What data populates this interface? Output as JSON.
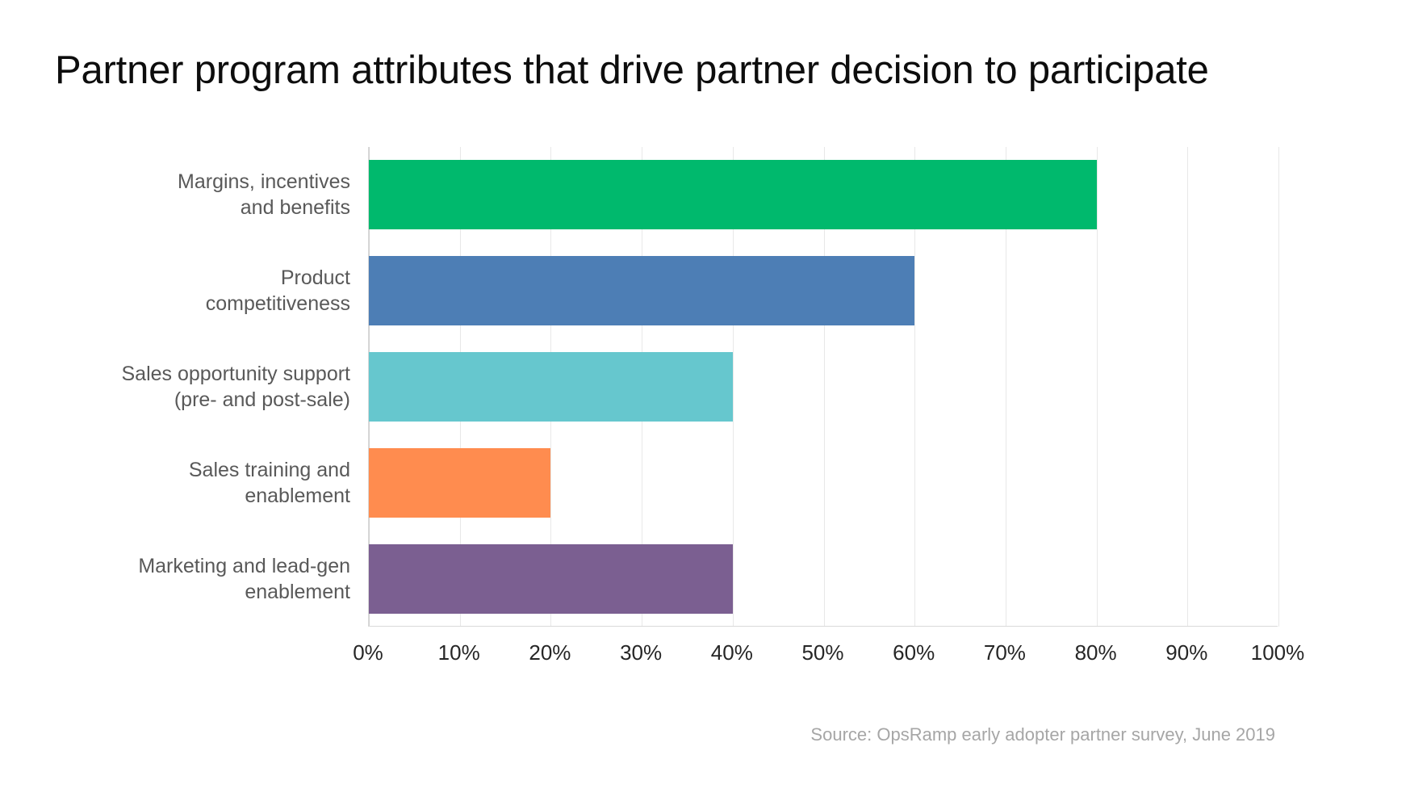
{
  "title": "Partner program attributes that drive partner decision to participate",
  "source_note": "Source:  OpsRamp early adopter partner survey, June 2019",
  "chart_data": {
    "type": "bar",
    "orientation": "horizontal",
    "title": "Partner program attributes that drive partner decision to participate",
    "xlabel": "",
    "ylabel": "",
    "xlim": [
      0,
      100
    ],
    "grid": true,
    "legend": "none",
    "categories": [
      "Margins, incentives and benefits",
      "Product competitiveness",
      "Sales opportunity support (pre- and post-sale)",
      "Sales training and enablement",
      "Marketing and lead-gen enablement"
    ],
    "category_lines": [
      [
        "Margins, incentives",
        "and benefits"
      ],
      [
        "Product",
        "competitiveness"
      ],
      [
        "Sales opportunity support",
        "(pre- and post-sale)"
      ],
      [
        "Sales training and",
        "enablement"
      ],
      [
        "Marketing and lead-gen",
        "enablement"
      ]
    ],
    "values": [
      80,
      60,
      40,
      20,
      40
    ],
    "value_labels": [
      "80%",
      "60%",
      "40%",
      "20%",
      "40%"
    ],
    "colors": [
      "#00b96d",
      "#4d7eb5",
      "#66c7ce",
      "#ff8c4f",
      "#7b5f91"
    ],
    "tick_labels": [
      "0%",
      "10%",
      "20%",
      "30%",
      "40%",
      "50%",
      "60%",
      "70%",
      "80%",
      "90%",
      "100%"
    ],
    "tick_values": [
      0,
      10,
      20,
      30,
      40,
      50,
      60,
      70,
      80,
      90,
      100
    ]
  }
}
